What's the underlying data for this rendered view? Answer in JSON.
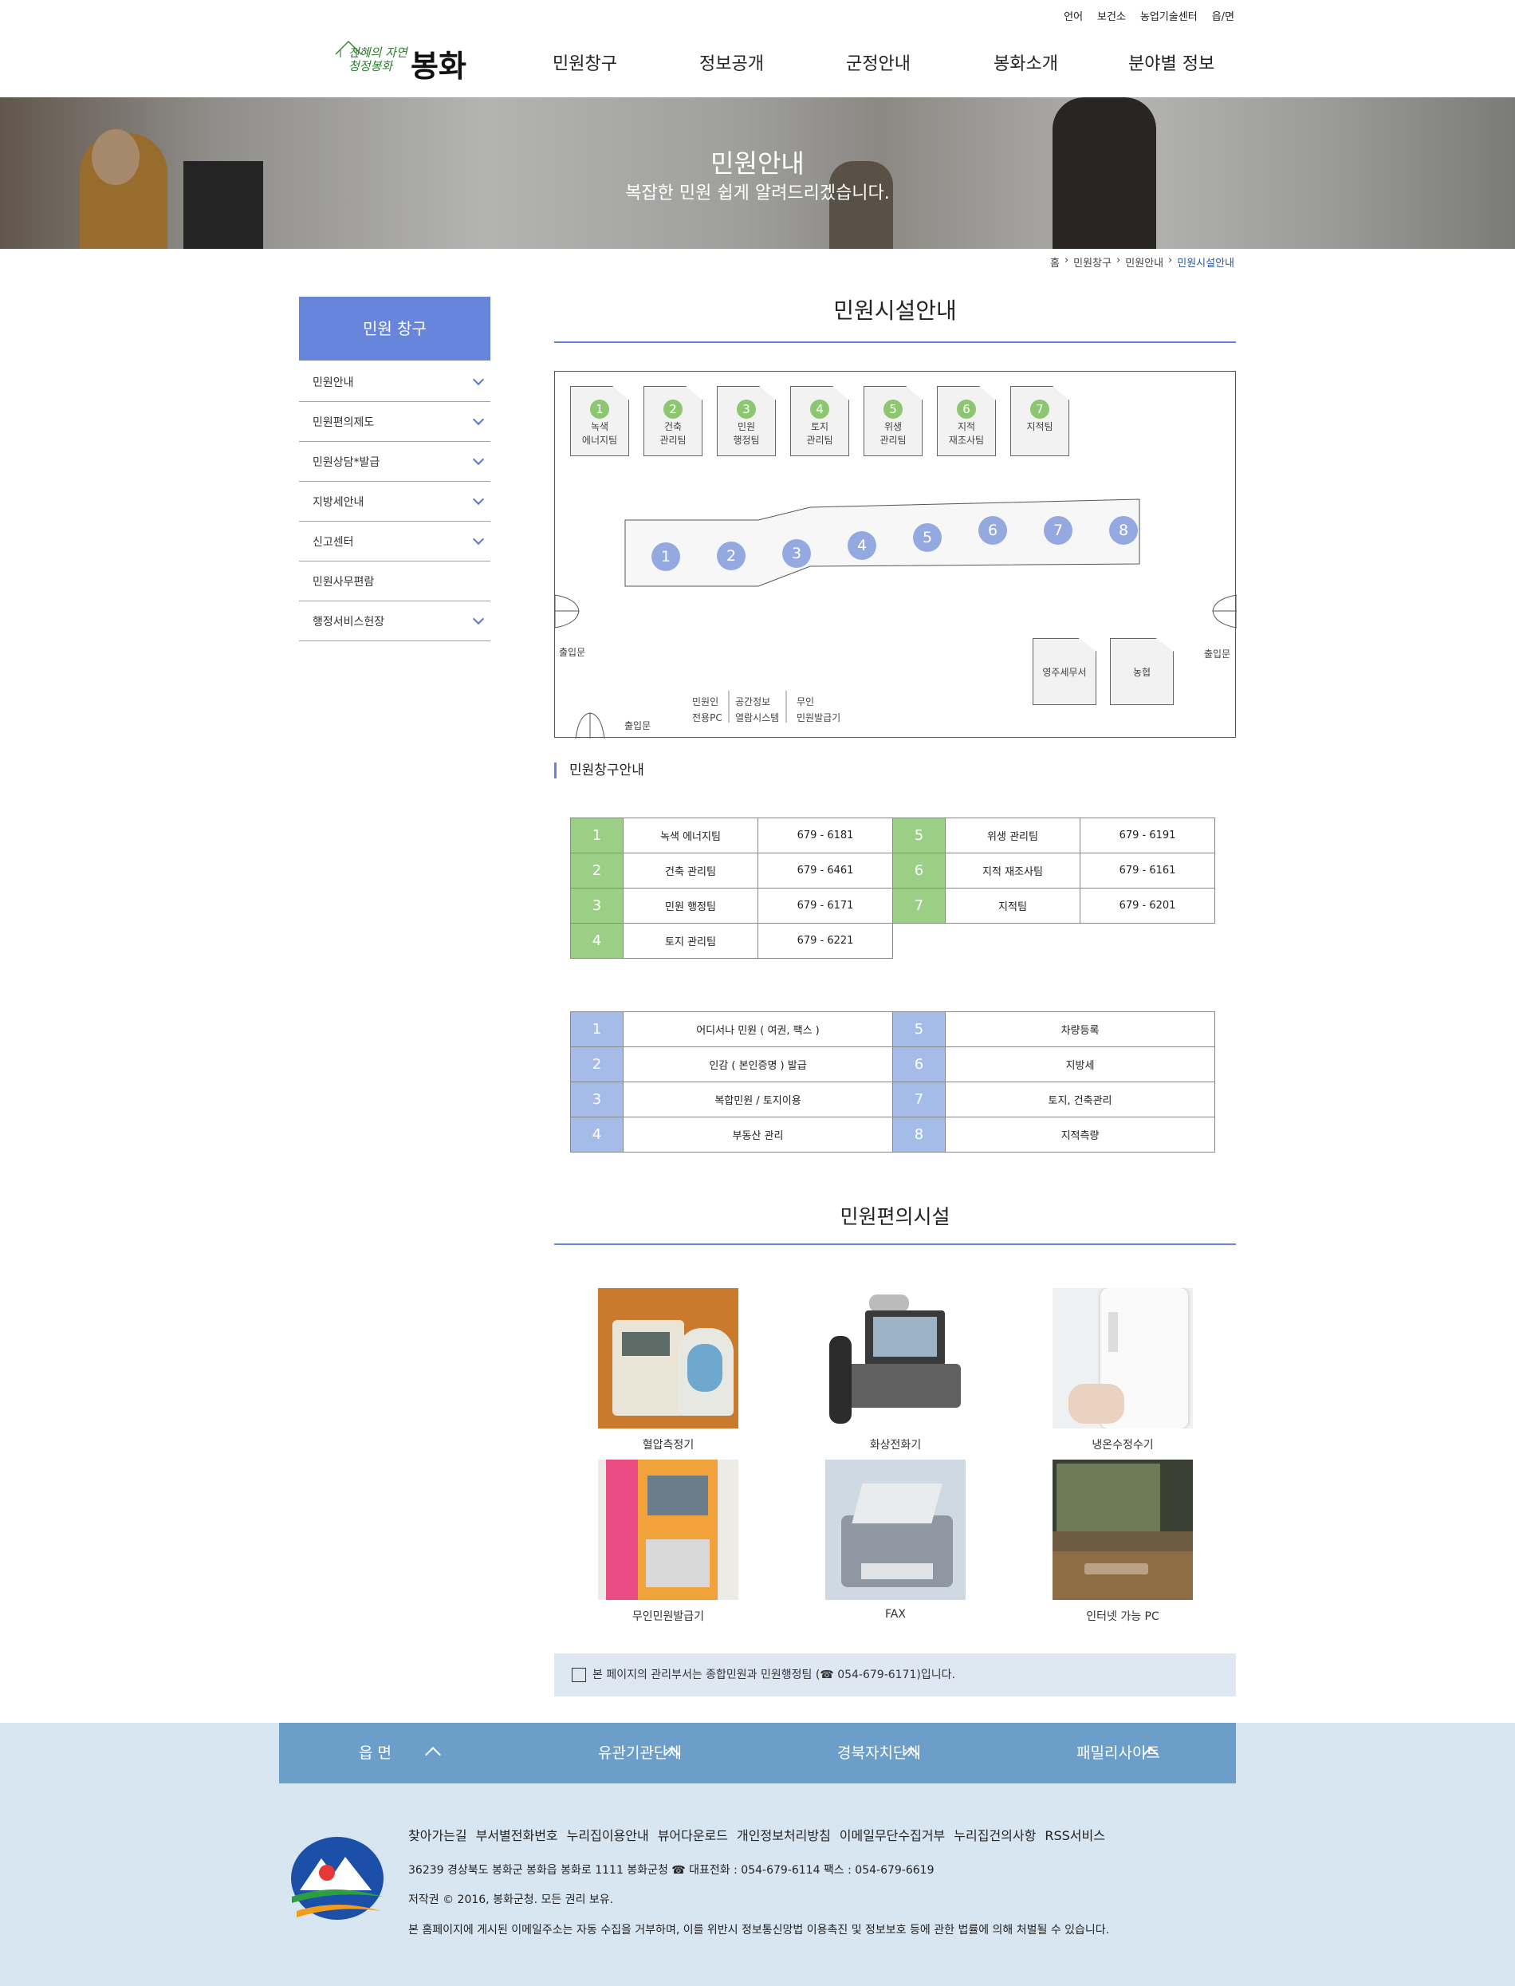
{
  "utility": [
    "언어",
    "보건소",
    "농업기술센터",
    "읍/면"
  ],
  "logo": {
    "slogan_1": "천혜의 자연",
    "slogan_2": "청정봉화",
    "name": "봉화"
  },
  "gnb": [
    "민원창구",
    "정보공개",
    "군정안내",
    "봉화소개",
    "분야별 정보"
  ],
  "banner": {
    "title": "민원안내",
    "subtitle": "복잡한 민원 쉽게 알려드리겠습니다."
  },
  "breadcrumb": [
    "홈",
    "민원창구",
    "민원안내",
    "민원시설안내"
  ],
  "sidebar": {
    "title": "민원 창구",
    "items": [
      {
        "label": "민원안내"
      },
      {
        "label": "민원편의제도"
      },
      {
        "label": "민원상담*발급"
      },
      {
        "label": "지방세안내"
      },
      {
        "label": "신고센터"
      },
      {
        "label": "민원사무편람"
      },
      {
        "label": "행정서비스헌장"
      }
    ]
  },
  "main": {
    "title": "민원시설안내",
    "floor": {
      "teams": [
        {
          "num": "1",
          "line1": "녹색",
          "line2": "에너지팀"
        },
        {
          "num": "2",
          "line1": "건축",
          "line2": "관리팀"
        },
        {
          "num": "3",
          "line1": "민원",
          "line2": "행정팀"
        },
        {
          "num": "4",
          "line1": "토지",
          "line2": "관리팀"
        },
        {
          "num": "5",
          "line1": "위생",
          "line2": "관리팀"
        },
        {
          "num": "6",
          "line1": "지적",
          "line2": "재조사팀"
        },
        {
          "num": "7",
          "line1": "지적팀",
          "line2": ""
        }
      ],
      "counters": [
        "1",
        "2",
        "3",
        "4",
        "5",
        "6",
        "7",
        "8"
      ],
      "services": [
        "영주세무서",
        "농협"
      ],
      "door_label": "출입문",
      "kiosks": [
        {
          "line1": "민원인",
          "line2": "전용PC"
        },
        {
          "line1": "공간정보",
          "line2": "열람시스템"
        },
        {
          "line1": "무인",
          "line2": "민원발급기"
        }
      ]
    },
    "section_title": "민원창구안내",
    "teams_table": [
      [
        {
          "num": "1",
          "name": "녹색 에너지팀",
          "tel": "679 - 6181"
        },
        {
          "num": "5",
          "name": "위생 관리팀",
          "tel": "679 - 6191"
        }
      ],
      [
        {
          "num": "2",
          "name": "건축 관리팀",
          "tel": "679 - 6461"
        },
        {
          "num": "6",
          "name": "지적 재조사팀",
          "tel": "679 - 6161"
        }
      ],
      [
        {
          "num": "3",
          "name": "민원 행정팀",
          "tel": "679 - 6171"
        },
        {
          "num": "7",
          "name": "지적팀",
          "tel": "679 - 6201"
        }
      ],
      [
        {
          "num": "4",
          "name": "토지 관리팀",
          "tel": "679 - 6221"
        }
      ]
    ],
    "counters_table": [
      [
        {
          "num": "1",
          "name": "어디서나 민원 ( 여권, 팩스 )"
        },
        {
          "num": "5",
          "name": "차량등록"
        }
      ],
      [
        {
          "num": "2",
          "name": "인감 ( 본인증명 ) 발급"
        },
        {
          "num": "6",
          "name": "지방세"
        }
      ],
      [
        {
          "num": "3",
          "name": "복합민원 / 토지이용"
        },
        {
          "num": "7",
          "name": "토지, 건축관리"
        }
      ],
      [
        {
          "num": "4",
          "name": "부동산 관리"
        },
        {
          "num": "8",
          "name": "지적측량"
        }
      ]
    ],
    "facilities_title": "민원편의시설",
    "facilities": [
      "혈압측정기",
      "화상전화기",
      "냉온수정수기",
      "무인민원발급기",
      "FAX",
      "인터넷 가능 PC"
    ],
    "notice": "본 페이지의 관리부서는 종합민원과 민원행정팀 (☎ 054-679-6171)입니다."
  },
  "footer": {
    "bar": [
      "읍 면",
      "유관기관단체",
      "경북자치단체",
      "패밀리사이트"
    ],
    "links": [
      "찾아가는길",
      "부서별전화번호",
      "누리집이용안내",
      "뷰어다운로드",
      "개인정보처리방침",
      "이메일무단수집거부",
      "누리집건의사항",
      "RSS서비스"
    ],
    "address": "36239 경상북도 봉화군 봉화읍 봉화로 1111 봉화군청 ☎ 대표전화 : 054-679-6114 팩스 : 054-679-6619",
    "copyright": "저작권 © 2016, 봉화군청. 모든 권리 보유.",
    "disclaimer": "본 홈페이지에 게시된 이메일주소는 자동 수집을 거부하며, 이를 위반시 정보통신망법 이용촉진 및 정보보호 등에 관한 법률에 의해 처벌될 수 있습니다."
  }
}
